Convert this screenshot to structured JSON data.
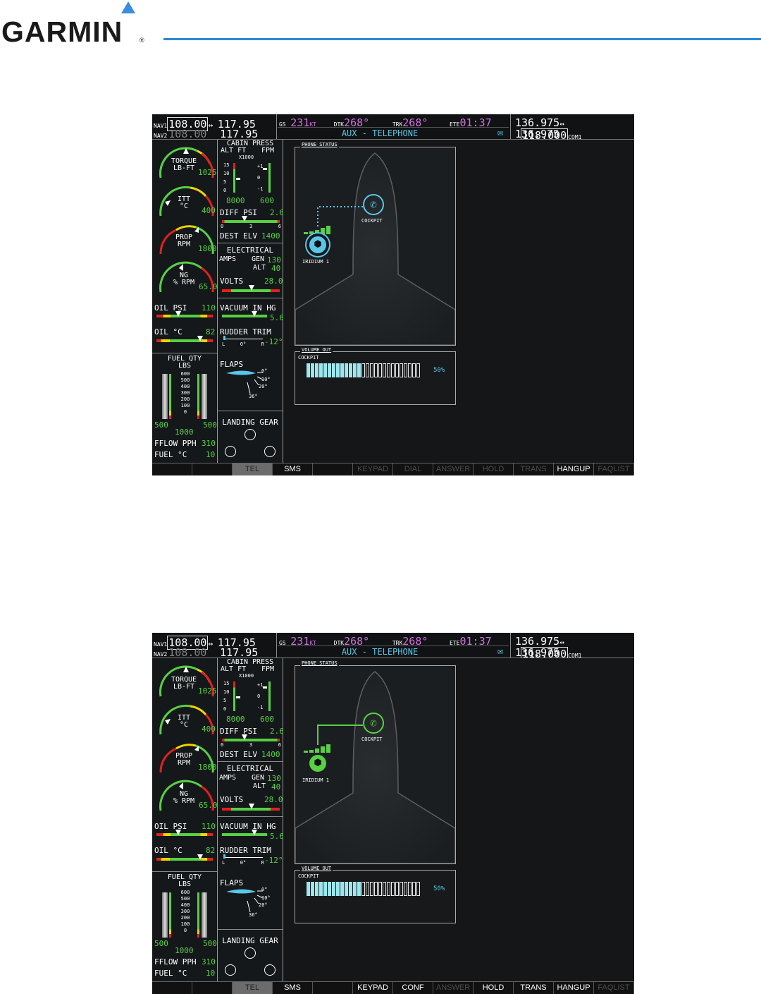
{
  "brand": {
    "name": "GARMIN",
    "reg": "®"
  },
  "screens": [
    {
      "nav": {
        "nav1_label": "NAV1",
        "nav1_active": "108.00",
        "nav1_standby": "117.95",
        "nav2_label": "NAV2",
        "nav2_active": "108.00",
        "nav2_standby": "117.95",
        "swap": "↔"
      },
      "flight": {
        "gs_label": "GS",
        "gs_value": "231",
        "gs_unit": "KT",
        "dtk_label": "DTK",
        "dtk_value": "268°",
        "trk_label": "TRK",
        "trk_value": "268°",
        "ete_label": "ETE",
        "ete_value": "01:37",
        "page_title": "AUX - TELEPHONE"
      },
      "com": {
        "com1_active": "136.975",
        "com1_standby": "118.000",
        "com1_label": "COM1",
        "com2_active": "136.975",
        "com2_standby": "118.000",
        "com2_label": "COM2",
        "swap": "↔"
      },
      "engine": {
        "torque_name": "TORQUE\nLB-FT",
        "torque_value": "1025",
        "itt_name": "ITT\n°C",
        "itt_value": "400",
        "prop_name": "PROP\nRPM",
        "prop_value": "1800",
        "ng_name": "NG\n% RPM",
        "ng_value": "65.0",
        "oil_psi_label": "OIL PSI",
        "oil_psi_value": "110",
        "oil_c_label": "OIL °C",
        "oil_c_value": "82",
        "fuel_title": "FUEL QTY\nLBS",
        "fuel_scale": [
          "600",
          "500",
          "400",
          "300",
          "200",
          "100",
          "0"
        ],
        "fuel_left": "500",
        "fuel_right": "500",
        "fuel_total": "1000",
        "fflow_label": "FFLOW PPH",
        "fflow_value": "310",
        "fuel_c_label": "FUEL °C",
        "fuel_c_value": "10"
      },
      "systems": {
        "cabin_title": "CABIN PRESS",
        "alt_ft": "ALT FT",
        "fpm": "FPM",
        "x1000": "X1000",
        "alt_scale": [
          "15",
          "10",
          "5",
          "0"
        ],
        "fpm_scale": [
          "+1",
          "0",
          "-1"
        ],
        "cabin_alt_value": "8000",
        "cabin_fpm_value": "600",
        "diff_psi_label": "DIFF PSI",
        "diff_psi_value": "2.6",
        "diff_scale": [
          "0",
          "3",
          "6"
        ],
        "dest_elv_label": "DEST ELV",
        "dest_elv_value": "1400",
        "elec_title": "ELECTRICAL",
        "amps": "AMPS",
        "gen": "GEN",
        "gen_value": "130",
        "alt": "ALT",
        "alt_value": "40",
        "volts_label": "VOLTS",
        "volts_value": "28.0",
        "vacuum_label": "VACUUM IN HG",
        "vacuum_value": "5.6",
        "rudder_label": "RUDDER TRIM",
        "rudder_scale": [
          "L",
          "0°",
          "R"
        ],
        "rudder_value": "-12°",
        "flaps_label": "FLAPS",
        "flaps_marks": [
          "0°",
          "10°",
          "20°",
          "36°"
        ],
        "gear_label": "LANDING GEAR"
      },
      "phone": {
        "status_title": "PHONE STATUS",
        "cockpit_label": "COCKPIT",
        "iridium_label": "IRIDIUM 1",
        "link": "dotted",
        "color": "#59c7e8"
      },
      "volume": {
        "title": "VOLUME OUT",
        "channel": "COCKPIT",
        "level_pct": "50%",
        "segments_on": 13,
        "segments_total": 27
      },
      "softkeys": [
        {
          "label": "",
          "state": "normal"
        },
        {
          "label": "",
          "state": "normal"
        },
        {
          "label": "TEL",
          "state": "selected"
        },
        {
          "label": "SMS",
          "state": "normal"
        },
        {
          "label": "",
          "state": "normal"
        },
        {
          "label": "KEYPAD",
          "state": "dim"
        },
        {
          "label": "DIAL",
          "state": "dim"
        },
        {
          "label": "ANSWER",
          "state": "dim"
        },
        {
          "label": "HOLD",
          "state": "dim"
        },
        {
          "label": "TRANS",
          "state": "dim"
        },
        {
          "label": "HANGUP",
          "state": "normal"
        },
        {
          "label": "FAQLIST",
          "state": "dim"
        }
      ]
    },
    {
      "nav": {
        "nav1_label": "NAV1",
        "nav1_active": "108.00",
        "nav1_standby": "117.95",
        "nav2_label": "NAV2",
        "nav2_active": "108.00",
        "nav2_standby": "117.95",
        "swap": "↔"
      },
      "flight": {
        "gs_label": "GS",
        "gs_value": "231",
        "gs_unit": "KT",
        "dtk_label": "DTK",
        "dtk_value": "268°",
        "trk_label": "TRK",
        "trk_value": "268°",
        "ete_label": "ETE",
        "ete_value": "01:37",
        "page_title": "AUX - TELEPHONE"
      },
      "com": {
        "com1_active": "136.975",
        "com1_standby": "118.000",
        "com1_label": "COM1",
        "com2_active": "136.975",
        "com2_standby": "118.000",
        "com2_label": "COM2",
        "swap": "↔"
      },
      "engine": {
        "torque_name": "TORQUE\nLB-FT",
        "torque_value": "1025",
        "itt_name": "ITT\n°C",
        "itt_value": "400",
        "prop_name": "PROP\nRPM",
        "prop_value": "1800",
        "ng_name": "NG\n% RPM",
        "ng_value": "65.0",
        "oil_psi_label": "OIL PSI",
        "oil_psi_value": "110",
        "oil_c_label": "OIL °C",
        "oil_c_value": "82",
        "fuel_title": "FUEL QTY\nLBS",
        "fuel_scale": [
          "600",
          "500",
          "400",
          "300",
          "200",
          "100",
          "0"
        ],
        "fuel_left": "500",
        "fuel_right": "500",
        "fuel_total": "1000",
        "fflow_label": "FFLOW PPH",
        "fflow_value": "310",
        "fuel_c_label": "FUEL °C",
        "fuel_c_value": "10"
      },
      "systems": {
        "cabin_title": "CABIN PRESS",
        "alt_ft": "ALT FT",
        "fpm": "FPM",
        "x1000": "X1000",
        "alt_scale": [
          "15",
          "10",
          "5",
          "0"
        ],
        "fpm_scale": [
          "+1",
          "0",
          "-1"
        ],
        "cabin_alt_value": "8000",
        "cabin_fpm_value": "600",
        "diff_psi_label": "DIFF PSI",
        "diff_psi_value": "2.6",
        "diff_scale": [
          "0",
          "3",
          "6"
        ],
        "dest_elv_label": "DEST ELV",
        "dest_elv_value": "1400",
        "elec_title": "ELECTRICAL",
        "amps": "AMPS",
        "gen": "GEN",
        "gen_value": "130",
        "alt": "ALT",
        "alt_value": "40",
        "volts_label": "VOLTS",
        "volts_value": "28.0",
        "vacuum_label": "VACUUM IN HG",
        "vacuum_value": "5.6",
        "rudder_label": "RUDDER TRIM",
        "rudder_scale": [
          "L",
          "0°",
          "R"
        ],
        "rudder_value": "-12°",
        "flaps_label": "FLAPS",
        "flaps_marks": [
          "0°",
          "10°",
          "20°",
          "36°"
        ],
        "gear_label": "LANDING GEAR"
      },
      "phone": {
        "status_title": "PHONE STATUS",
        "cockpit_label": "COCKPIT",
        "iridium_label": "IRIDIUM 1",
        "link": "solid",
        "color": "#57d043"
      },
      "volume": {
        "title": "VOLUME OUT",
        "channel": "COCKPIT",
        "level_pct": "50%",
        "segments_on": 13,
        "segments_total": 27
      },
      "softkeys": [
        {
          "label": "",
          "state": "normal"
        },
        {
          "label": "",
          "state": "normal"
        },
        {
          "label": "TEL",
          "state": "selected"
        },
        {
          "label": "SMS",
          "state": "normal"
        },
        {
          "label": "",
          "state": "normal"
        },
        {
          "label": "KEYPAD",
          "state": "normal"
        },
        {
          "label": "CONF",
          "state": "normal"
        },
        {
          "label": "ANSWER",
          "state": "dim"
        },
        {
          "label": "HOLD",
          "state": "normal"
        },
        {
          "label": "TRANS",
          "state": "normal"
        },
        {
          "label": "HANGUP",
          "state": "normal"
        },
        {
          "label": "FAQLIST",
          "state": "dim"
        }
      ]
    }
  ]
}
